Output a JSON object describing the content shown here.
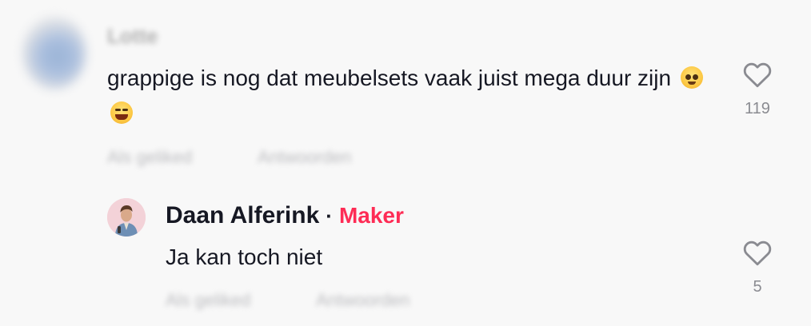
{
  "comments": [
    {
      "username": "Lotte",
      "text": "grappige is nog dat meubelsets vaak juist mega duur zijn",
      "emojis": [
        "pleading-face-emoji",
        "face-with-tears-of-joy-emoji"
      ],
      "like_count": "119",
      "liked_by_creator_label": "Als geliked",
      "reply_label": "Antwoorden"
    },
    {
      "username": "Daan Alferink",
      "separator": "·",
      "badge": "Maker",
      "text": "Ja kan toch niet",
      "like_count": "5",
      "liked_by_creator_label": "Als geliked",
      "reply_label": "Antwoorden"
    }
  ],
  "icons": {
    "like": "heart-outline-icon"
  },
  "colors": {
    "background": "#f8f8f8",
    "text_primary": "#161823",
    "text_secondary": "#8a8b91",
    "creator_badge": "#fe2c55"
  }
}
